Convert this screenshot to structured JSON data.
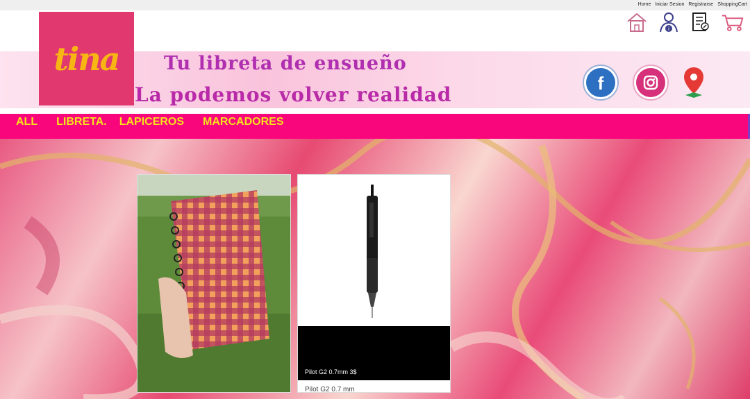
{
  "top_links": [
    "Home",
    "Iniciar Sesion",
    "Registrarse",
    "ShoppingCart"
  ],
  "logo": {
    "text": "tina"
  },
  "tagline": {
    "line1": "Tu libreta de ensueño",
    "line2": "La podemos volver realidad"
  },
  "header_icons": [
    "home-icon",
    "user-info-icon",
    "document-edit-icon",
    "cart-icon"
  ],
  "social_icons": [
    "facebook-icon",
    "instagram-icon",
    "location-pin-icon"
  ],
  "nav": [
    "ALL",
    "LIBRETA.",
    "LAPICEROS",
    "MARCADORES"
  ],
  "products": [
    {
      "name": "",
      "caption_overlay": ""
    },
    {
      "name": "Pilot G2 0.7 mm",
      "caption_overlay": "Pilot G2 0.7mm 3$"
    }
  ],
  "colors": {
    "brand_pink": "#e0386f",
    "nav_bg": "#f9057c",
    "nav_text": "#f7e21d",
    "logo_text": "#f7b614",
    "tagline": "#b02fb0"
  }
}
